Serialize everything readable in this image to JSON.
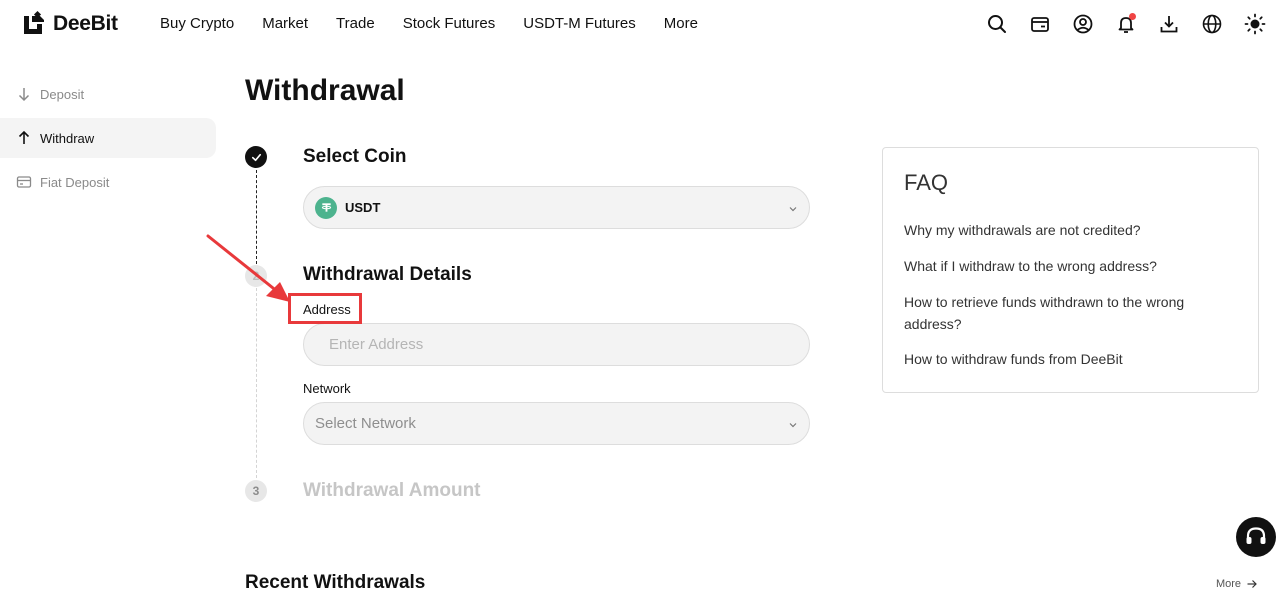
{
  "brand": {
    "name": "DeeBit"
  },
  "nav": {
    "items": [
      "Buy Crypto",
      "Market",
      "Trade",
      "Stock Futures",
      "USDT-M Futures",
      "More"
    ]
  },
  "header_icons": [
    "search-icon",
    "wallet-icon",
    "account-icon",
    "notification-bell-icon",
    "download-icon",
    "globe-icon",
    "theme-sun-icon"
  ],
  "sidebar": {
    "items": [
      {
        "label": "Deposit",
        "icon": "arrow-down-icon",
        "active": false
      },
      {
        "label": "Withdraw",
        "icon": "arrow-up-icon",
        "active": true
      },
      {
        "label": "Fiat Deposit",
        "icon": "card-icon",
        "active": false
      }
    ]
  },
  "page": {
    "title": "Withdrawal"
  },
  "steps": {
    "s1": {
      "title": "Select Coin",
      "status": "done"
    },
    "s2": {
      "number": "2",
      "title": "Withdrawal Details"
    },
    "s3": {
      "number": "3",
      "title": "Withdrawal Amount"
    }
  },
  "coin_select": {
    "selected": "USDT",
    "icon": "tether-icon"
  },
  "address_field": {
    "label": "Address",
    "placeholder": "Enter Address",
    "value": ""
  },
  "network_field": {
    "label": "Network",
    "placeholder": "Select Network"
  },
  "faq": {
    "title": "FAQ",
    "questions": [
      "Why my withdrawals are not credited?",
      "What if I withdraw to the wrong address?",
      "How to retrieve funds withdrawn to the wrong address?",
      "How to withdraw funds from DeeBit"
    ]
  },
  "recent": {
    "title": "Recent Withdrawals",
    "more_label": "More"
  },
  "colors": {
    "highlight": "#e8393b",
    "coin": "#4db38e",
    "notification": "#f04444"
  }
}
